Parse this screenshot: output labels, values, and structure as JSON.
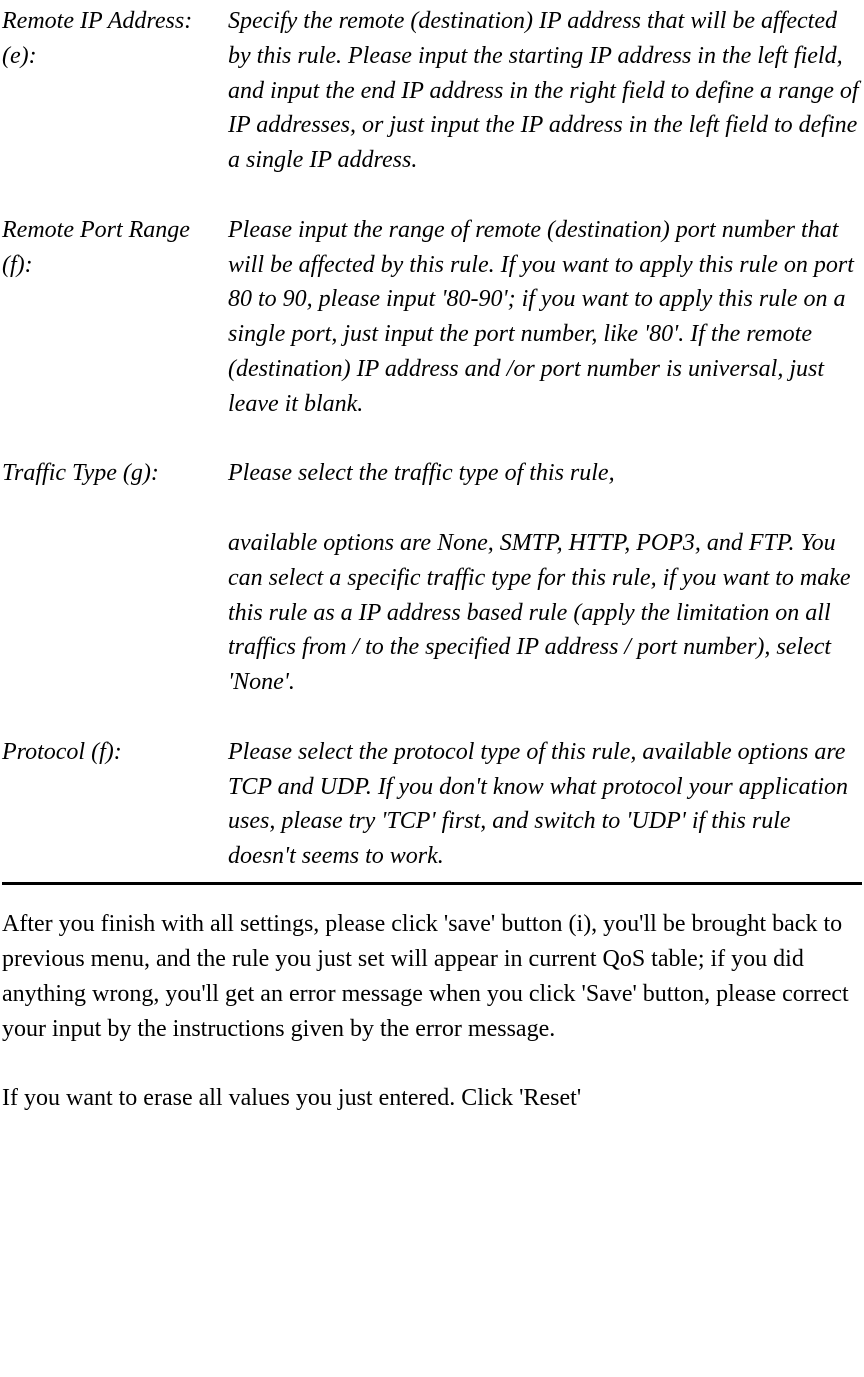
{
  "defs": {
    "remoteIp": {
      "label": "Remote IP Address: (e):",
      "desc": "Specify the remote (destination) IP address that will be affected by this rule. Please input the starting IP address in the left field, and input the end IP address in the right field to define a range of IP addresses, or just input the IP address in the left field to define a single IP address."
    },
    "remotePort": {
      "label": "Remote Port Range (f):",
      "desc": "Please input the range of remote (destination) port number that will be affected by this rule. If you want to apply this rule on port 80 to 90, please input '80-90'; if you want to apply this rule on a single port, just input the port number, like '80'. If the remote (destination) IP address and /or port number is universal, just leave it blank."
    },
    "trafficType": {
      "label": "Traffic Type (g):",
      "desc1": "Please select the traffic type of this rule,",
      "desc2": "available options are None, SMTP, HTTP, POP3, and FTP. You can select a specific traffic type for this rule, if you want to make this rule as a IP address based rule (apply the limitation on all traffics from / to the specified IP address / port number), select 'None'."
    },
    "protocol": {
      "label": "Protocol (f):",
      "desc": "Please select the protocol type of this rule, available options are TCP and UDP. If you don't know what protocol your application uses, please try 'TCP' first, and switch to 'UDP' if this rule doesn't seems to work."
    }
  },
  "footer": {
    "p1": "After you finish with all settings, please click 'save' button (i), you'll be brought back to previous menu, and the rule you just set will appear in current QoS table; if you did anything wrong, you'll get an error message when you click 'Save' button, please correct your input by the instructions given by the error message.",
    "p2": "If you want to erase all values you just entered. Click 'Reset'"
  }
}
